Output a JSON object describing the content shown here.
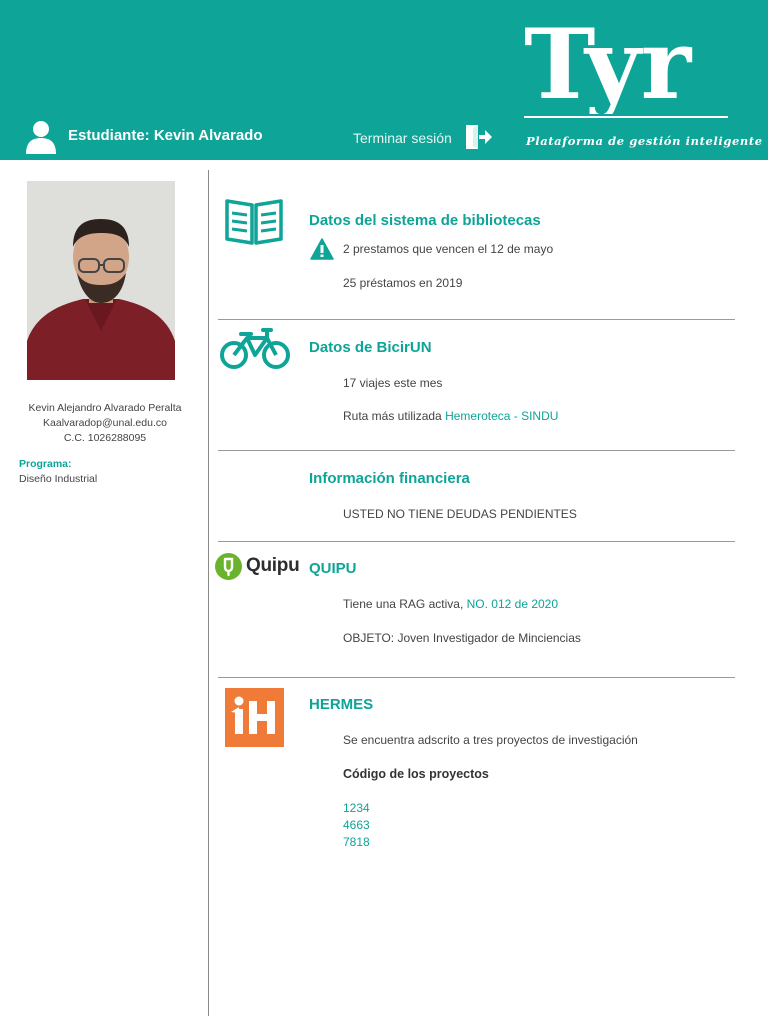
{
  "brand": {
    "logo_text": "Tyr",
    "tagline": "Plataforma de gestión inteligente"
  },
  "header": {
    "user_title": "Estudiante: Kevin Alvarado",
    "logout_label": "Terminar sesión"
  },
  "profile": {
    "full_name": "Kevin Alejandro Alvarado Peralta",
    "email": "Kaalvaradop@unal.edu.co",
    "id_doc": "C.C. 1026288095",
    "program_label": "Programa:",
    "program_value": "Diseño Industrial"
  },
  "sections": {
    "library": {
      "title": "Datos del sistema de bibliotecas",
      "warning": "2 prestamos que vencen el 12 de mayo",
      "loans": "25 préstamos en 2019"
    },
    "bicirun": {
      "title": "Datos de BicirUN",
      "trips": "17 viajes este mes",
      "route_prefix": "Ruta más utilizada",
      "route_value": "Hemeroteca - SINDU"
    },
    "finance": {
      "title": "Información financiera",
      "status": "USTED NO TIENE DEUDAS PENDIENTES"
    },
    "quipu": {
      "logo_text": "Quipu",
      "title": "QUIPU",
      "rag_prefix": "Tiene una RAG activa,",
      "rag_number": "NO. 012 de 2020",
      "object": "OBJETO:  Joven Investigador de Minciencias"
    },
    "hermes": {
      "title": "HERMES",
      "description": "Se encuentra adscrito a tres proyectos de investigación",
      "codes_label": "Código de los proyectos",
      "codes": [
        "1234",
        "4663",
        "7818"
      ]
    }
  },
  "colors": {
    "primary": "#0ea497",
    "quipu_green": "#6ab42d",
    "hermes_orange": "#f07a38",
    "warning_icon": "#0ea497"
  },
  "icons": {
    "user": "user-icon",
    "logout": "logout-icon",
    "library": "open-book-icon",
    "bike": "bicycle-icon",
    "warning": "warning-icon",
    "quipu": "quipu-logo",
    "hermes": "hermes-logo"
  }
}
